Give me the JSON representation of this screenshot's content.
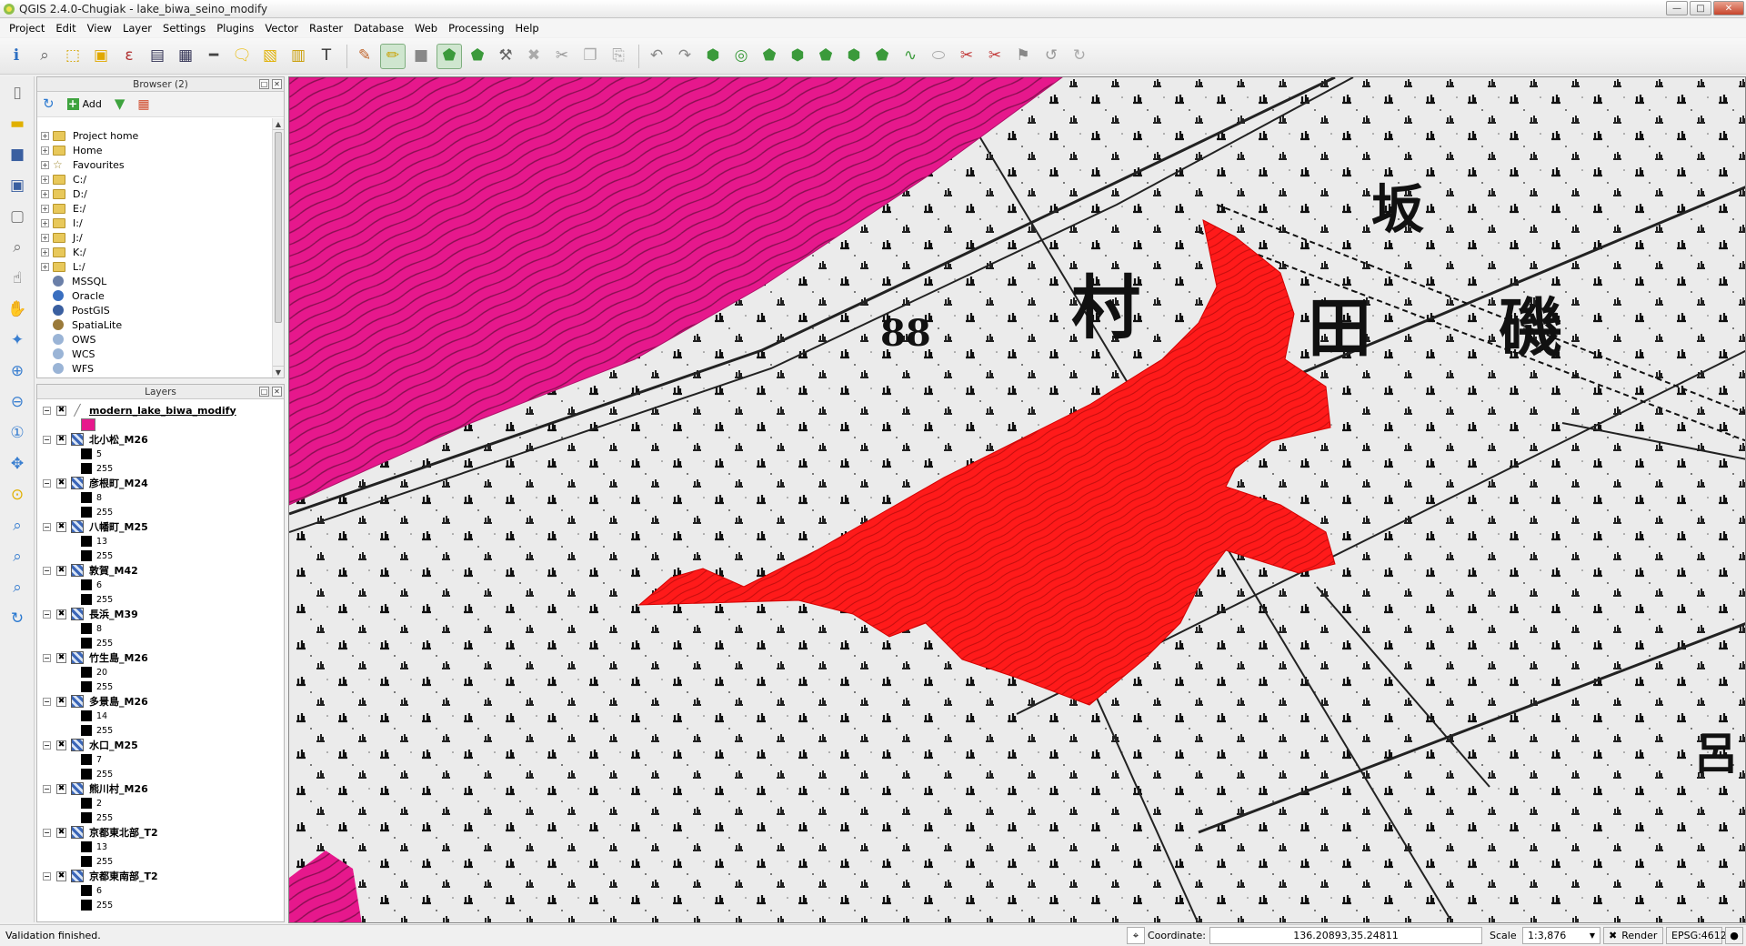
{
  "window": {
    "title": "QGIS 2.4.0-Chugiak - lake_biwa_seino_modify",
    "controls": [
      "minimize",
      "maximize",
      "close"
    ]
  },
  "menu": [
    "Project",
    "Edit",
    "View",
    "Layer",
    "Settings",
    "Plugins",
    "Vector",
    "Raster",
    "Database",
    "Web",
    "Processing",
    "Help"
  ],
  "browser": {
    "title": "Browser (2)",
    "add_label": "Add",
    "items": [
      {
        "label": "Project home",
        "icon": "folder-icon",
        "expandable": true
      },
      {
        "label": "Home",
        "icon": "folder-icon",
        "expandable": true
      },
      {
        "label": "Favourites",
        "icon": "star-icon",
        "expandable": true
      },
      {
        "label": "C:/",
        "icon": "folder-icon",
        "expandable": true
      },
      {
        "label": "D:/",
        "icon": "folder-icon",
        "expandable": true
      },
      {
        "label": "E:/",
        "icon": "folder-icon",
        "expandable": true
      },
      {
        "label": "I:/",
        "icon": "folder-icon",
        "expandable": true
      },
      {
        "label": "J:/",
        "icon": "folder-icon",
        "expandable": true
      },
      {
        "label": "K:/",
        "icon": "folder-icon",
        "expandable": true
      },
      {
        "label": "L:/",
        "icon": "folder-icon",
        "expandable": true
      },
      {
        "label": "MSSQL",
        "icon": "mssql-icon",
        "expandable": false
      },
      {
        "label": "Oracle",
        "icon": "oracle-icon",
        "expandable": false
      },
      {
        "label": "PostGIS",
        "icon": "postgis-icon",
        "expandable": false
      },
      {
        "label": "SpatiaLite",
        "icon": "spatialite-icon",
        "expandable": false
      },
      {
        "label": "OWS",
        "icon": "ows-icon",
        "expandable": false
      },
      {
        "label": "WCS",
        "icon": "wcs-icon",
        "expandable": false
      },
      {
        "label": "WFS",
        "icon": "wfs-icon",
        "expandable": false
      }
    ]
  },
  "layers": {
    "title": "Layers",
    "items": [
      {
        "name": "modern_lake_biwa_modify",
        "type": "vector",
        "checked": true,
        "legend": {
          "fill": "#e6188c"
        }
      },
      {
        "name": "北小松_M26",
        "type": "raster",
        "checked": true,
        "legend": {
          "min": "5",
          "max": "255"
        }
      },
      {
        "name": "彦根町_M24",
        "type": "raster",
        "checked": true,
        "legend": {
          "min": "8",
          "max": "255"
        }
      },
      {
        "name": "八幡町_M25",
        "type": "raster",
        "checked": true,
        "legend": {
          "min": "13",
          "max": "255"
        }
      },
      {
        "name": "敦賀_M42",
        "type": "raster",
        "checked": true,
        "legend": {
          "min": "6",
          "max": "255"
        }
      },
      {
        "name": "長浜_M39",
        "type": "raster",
        "checked": true,
        "legend": {
          "min": "8",
          "max": "255"
        }
      },
      {
        "name": "竹生島_M26",
        "type": "raster",
        "checked": true,
        "legend": {
          "min": "20",
          "max": "255"
        }
      },
      {
        "name": "多景島_M26",
        "type": "raster",
        "checked": true,
        "legend": {
          "min": "14",
          "max": "255"
        }
      },
      {
        "name": "水口_M25",
        "type": "raster",
        "checked": true,
        "legend": {
          "min": "7",
          "max": "255"
        }
      },
      {
        "name": "熊川村_M26",
        "type": "raster",
        "checked": true,
        "legend": {
          "min": "2",
          "max": "255"
        }
      },
      {
        "name": "京都東北部_T2",
        "type": "raster",
        "checked": true,
        "legend": {
          "min": "13",
          "max": "255"
        }
      },
      {
        "name": "京都東南部_T2",
        "type": "raster",
        "checked": true,
        "legend": {
          "min": "6",
          "max": "255"
        }
      }
    ]
  },
  "map": {
    "labels": [
      "坂",
      "村",
      "田",
      "磯",
      "88",
      "呂"
    ],
    "colors": {
      "lake": "#e6188c",
      "selection": "#ff1a1a",
      "paper": "#ececec"
    }
  },
  "status": {
    "message": "Validation finished.",
    "coordinate_label": "Coordinate:",
    "coordinate_value": "136.20893,35.24811",
    "scale_label": "Scale",
    "scale_value": "1:3,876",
    "render_label": "Render",
    "crs": "EPSG:4612"
  }
}
